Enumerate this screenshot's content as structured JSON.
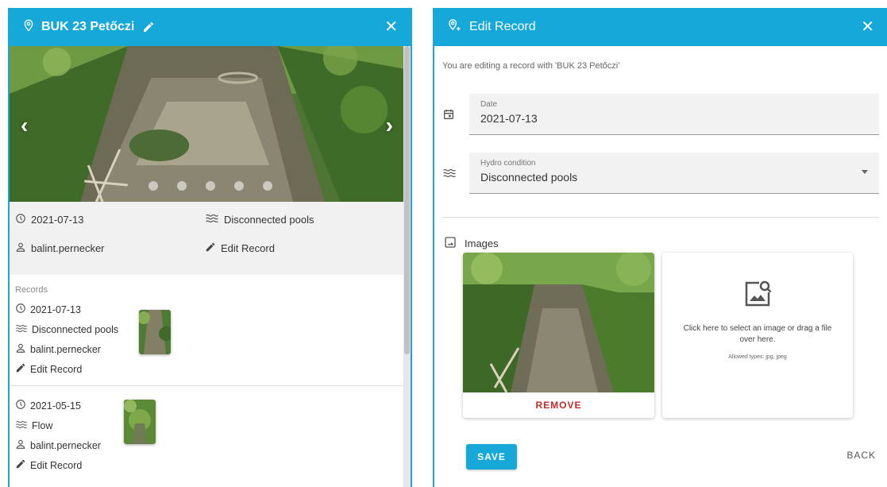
{
  "left_panel": {
    "title": "BUK 23 Petőczi",
    "summary": {
      "date": "2021-07-13",
      "condition": "Disconnected pools",
      "user": "balint.pernecker",
      "edit_label": "Edit Record"
    },
    "carousel": {
      "slide_count": 5,
      "active_index": 0
    },
    "records_label": "Records",
    "records": [
      {
        "date": "2021-07-13",
        "condition": "Disconnected pools",
        "user": "balint.pernecker",
        "edit_label": "Edit Record"
      },
      {
        "date": "2021-05-15",
        "condition": "Flow",
        "user": "balint.pernecker",
        "edit_label": "Edit Record"
      }
    ]
  },
  "right_panel": {
    "title": "Edit Record",
    "notice": "You are editing a record with 'BUK 23 Petőczi'",
    "date_field": {
      "label": "Date",
      "value": "2021-07-13"
    },
    "hydro_field": {
      "label": "Hydro condition",
      "value": "Disconnected pools"
    },
    "images_label": "Images",
    "remove_label": "REMOVE",
    "drop_text": "Click here to select an image or drag a file over here.",
    "allowed_types": "Allowed types: jpg, jpeg",
    "save_label": "SAVE",
    "back_label": "BACK"
  },
  "colors": {
    "accent": "#15a8d8",
    "remove": "#c62828"
  },
  "icons": [
    "map-marker-icon",
    "pencil-icon",
    "close-icon",
    "clock-icon",
    "waves-icon",
    "user-icon",
    "calendar-icon",
    "image-icon",
    "image-search-icon",
    "map-marker-plus-icon"
  ]
}
